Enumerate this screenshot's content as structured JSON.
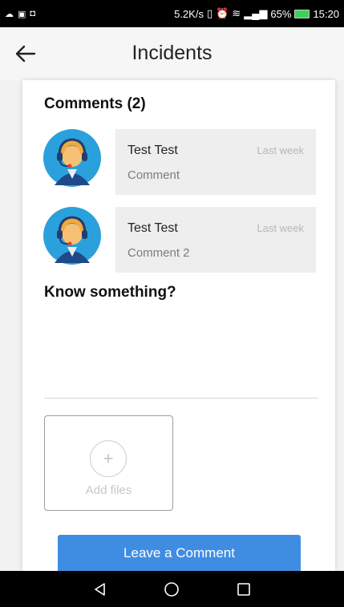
{
  "status_bar": {
    "network_speed": "5.2K/s",
    "battery": "65%",
    "time": "15:20",
    "left_icons": [
      "cloud-icon",
      "message-icon",
      "screen-icon"
    ]
  },
  "app_bar": {
    "title": "Incidents",
    "back_icon": "back-arrow-icon"
  },
  "comments": {
    "heading": "Comments (2)",
    "items": [
      {
        "author": "Test Test",
        "time": "Last week",
        "text": "Comment"
      },
      {
        "author": "Test Test",
        "time": "Last week",
        "text": "Comment 2"
      }
    ]
  },
  "compose": {
    "heading": "Know something?",
    "input_value": "",
    "add_files_label": "Add files",
    "submit_label": "Leave a Comment"
  },
  "colors": {
    "accent": "#3f8de3",
    "avatar_bg": "#2aa1dc",
    "bubble_bg": "#eeeeee"
  }
}
